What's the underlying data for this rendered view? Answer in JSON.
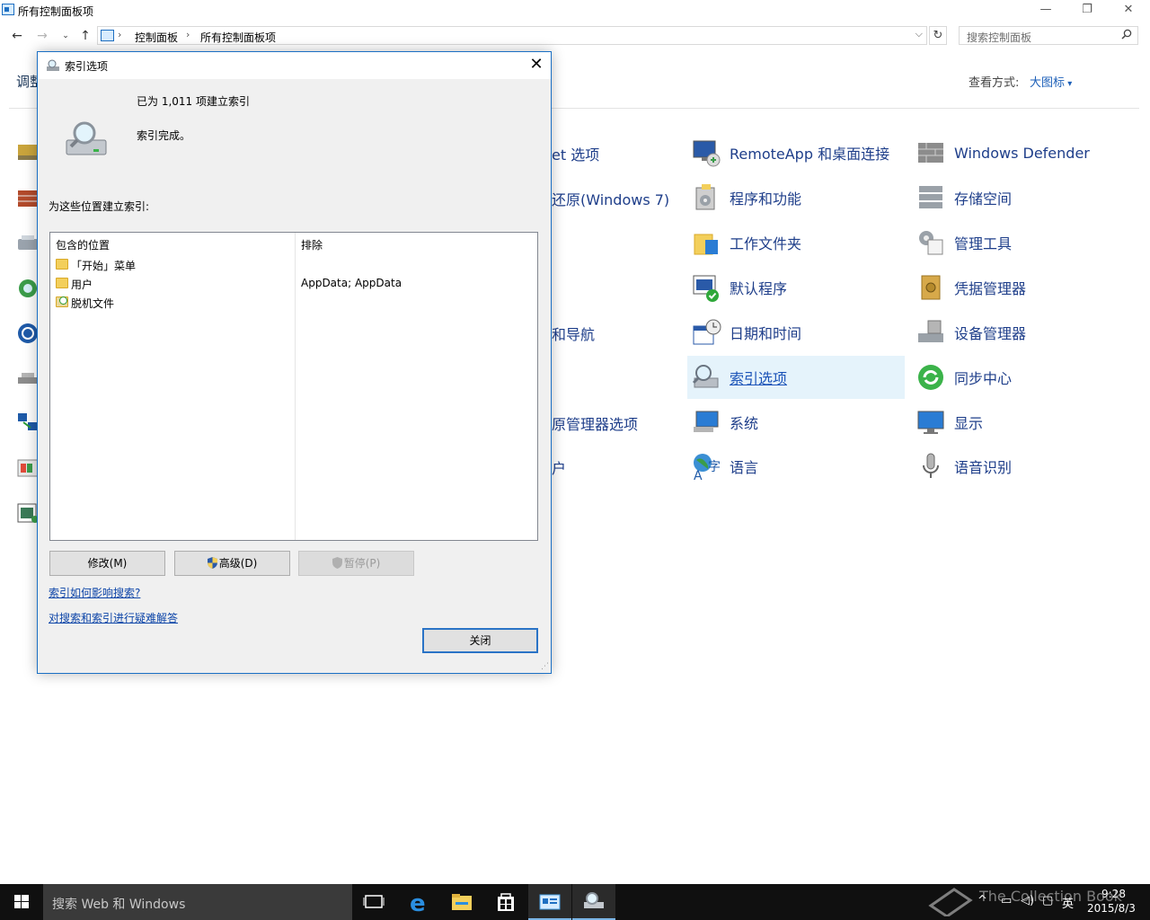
{
  "window": {
    "title": "所有控制面板项",
    "minimize_glyph": "—",
    "restore_glyph": "❐",
    "close_glyph": "✕"
  },
  "address": {
    "crumbs": [
      "控制面板",
      "所有控制面板项"
    ],
    "search_placeholder": "搜索控制面板"
  },
  "header": {
    "left_text": "调整",
    "view_label": "查看方式:",
    "view_value": "大图标"
  },
  "items_partial": [
    "et 选项",
    "还原(Windows 7)",
    "和导航",
    "原管理器选项",
    "户"
  ],
  "items_col3": [
    "RemoteApp 和桌面连接",
    "程序和功能",
    "工作文件夹",
    "默认程序",
    "日期和时间",
    "索引选项",
    "系统",
    "语言"
  ],
  "items_col4": [
    "Windows Defender",
    "存储空间",
    "管理工具",
    "凭据管理器",
    "设备管理器",
    "同步中心",
    "显示",
    "语音识别"
  ],
  "dialog": {
    "title": "索引选项",
    "count_text": "已为 1,011 项建立索引",
    "status_text": "索引完成。",
    "locations_caption": "为这些位置建立索引:",
    "col_included": "包含的位置",
    "col_excluded": "排除",
    "locations": [
      {
        "name": "「开始」菜单",
        "exclude": ""
      },
      {
        "name": "用户",
        "exclude": "AppData; AppData"
      },
      {
        "name": "脱机文件",
        "exclude": ""
      }
    ],
    "btn_modify": "修改(M)",
    "btn_advanced": "高级(D)",
    "btn_pause": "暂停(P)",
    "link_how": "索引如何影响搜索?",
    "link_troubleshoot": "对搜索和索引进行疑难解答",
    "btn_close": "关闭"
  },
  "taskbar": {
    "search_placeholder": "搜索 Web 和 Windows",
    "tray_ime": "英",
    "time": "9:28",
    "date": "2015/8/3",
    "watermark": "The Collection Book"
  },
  "colors": {
    "accent": "#1a6fc4",
    "link": "#1e3e8a",
    "taskbar": "#101010",
    "selection": "#e5f3fb"
  }
}
